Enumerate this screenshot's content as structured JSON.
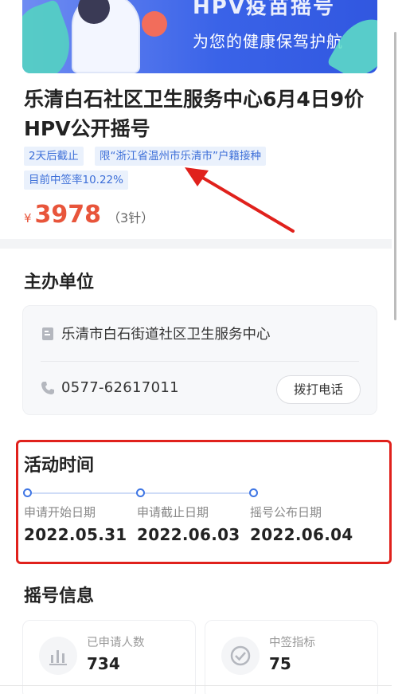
{
  "banner": {
    "headline": "HPV疫苗摇号",
    "subtitle": "为您的健康保驾护航"
  },
  "event": {
    "title": "乐清白石社区卫生服务中心6月4日9价HPV公开摇号",
    "tags": [
      "2天后截止",
      "限“浙江省温州市乐清市”户籍接种",
      "目前中签率10.22%"
    ],
    "price_symbol": "¥",
    "price": "3978",
    "price_unit": "（3针）"
  },
  "organizer": {
    "section_title": "主办单位",
    "name": "乐清市白石街道社区卫生服务中心",
    "phone": "0577-62617011",
    "call_button": "拨打电话"
  },
  "schedule": {
    "section_title": "活动时间",
    "items": [
      {
        "label": "申请开始日期",
        "date": "2022.05.31"
      },
      {
        "label": "申请截止日期",
        "date": "2022.06.03"
      },
      {
        "label": "摇号公布日期",
        "date": "2022.06.04"
      }
    ]
  },
  "lottery": {
    "section_title": "摇号信息",
    "stats": [
      {
        "label": "已申请人数",
        "value": "734",
        "icon": "bar-chart-icon"
      },
      {
        "label": "中签指标",
        "value": "75",
        "icon": "check-circle-icon"
      }
    ]
  },
  "colors": {
    "accent": "#3f76e4",
    "price": "#e8553b",
    "highlight_box": "#e0211c",
    "annotation_arrow": "#e0211c"
  }
}
